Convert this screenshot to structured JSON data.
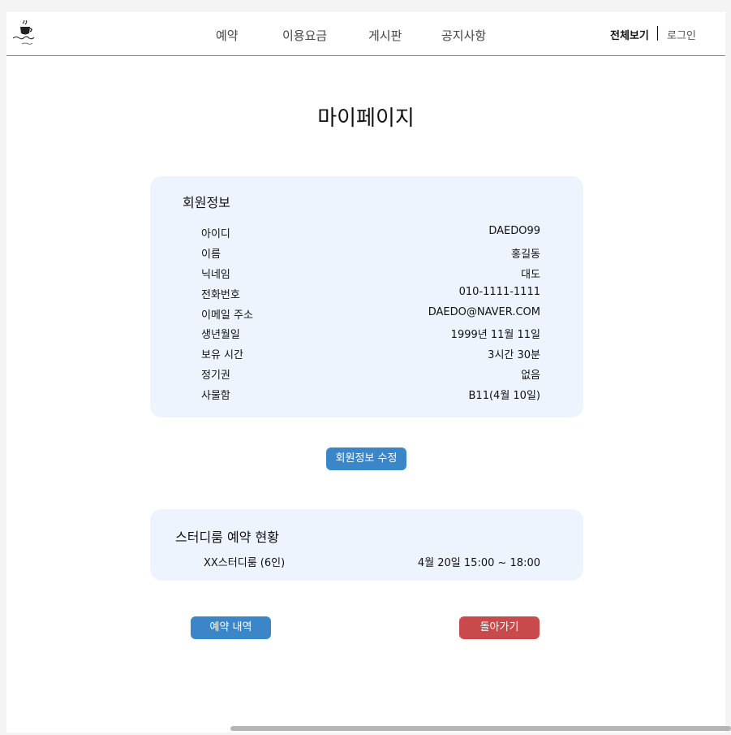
{
  "nav": {
    "items": [
      "예약",
      "이용요금",
      "게시판",
      "공지사항"
    ],
    "view_all": "전체보기",
    "login": "로그인"
  },
  "page_title": "마이페이지",
  "member_info": {
    "title": "회원정보",
    "rows": [
      {
        "label": "아이디",
        "value": "DAEDO99"
      },
      {
        "label": "이름",
        "value": "홍길동"
      },
      {
        "label": "닉네임",
        "value": "대도"
      },
      {
        "label": "전화번호",
        "value": "010-1111-1111"
      },
      {
        "label": "이메일 주소",
        "value": "DAEDO@NAVER.COM"
      },
      {
        "label": "생년월일",
        "value": "1999년 11월 11일"
      },
      {
        "label": "보유 시간",
        "value": "3시간 30분"
      },
      {
        "label": "정기권",
        "value": "없음"
      },
      {
        "label": "사물함",
        "value": "B11(4월 10일)"
      }
    ]
  },
  "edit_button": "회원정보 수정",
  "reservation": {
    "title": "스터디룸 예약 현황",
    "room": "XX스터디룸 (6인)",
    "time": "4월 20일 15:00 ~ 18:00"
  },
  "buttons": {
    "history": "예약 내역",
    "back": "돌아가기"
  },
  "colors": {
    "card_bg": "#eef4fd",
    "primary_button": "#3a86c8",
    "back_button": "#c84a4a"
  }
}
